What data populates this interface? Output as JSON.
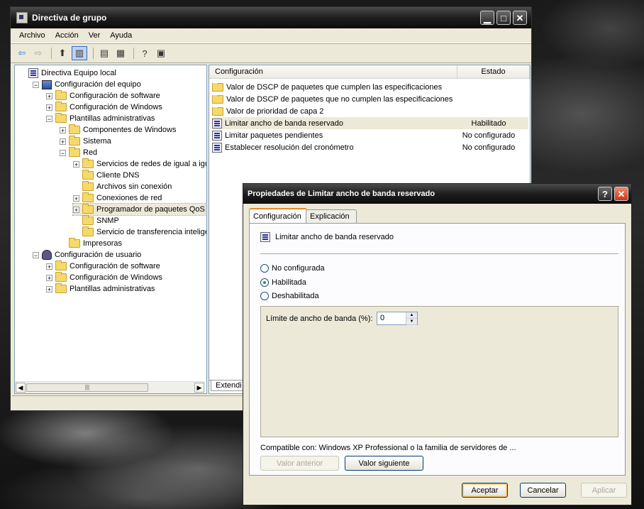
{
  "main_window": {
    "title": "Directiva de grupo",
    "menu": [
      "Archivo",
      "Acción",
      "Ver",
      "Ayuda"
    ],
    "tree": [
      {
        "label": "Directiva Equipo local",
        "icon": "policy-icon",
        "level": 0,
        "expander": ""
      },
      {
        "label": "Configuración del equipo",
        "icon": "computer-icon",
        "level": 1,
        "expander": "-"
      },
      {
        "label": "Configuración de software",
        "icon": "folder-icon",
        "level": 2,
        "expander": "+"
      },
      {
        "label": "Configuración de Windows",
        "icon": "folder-icon",
        "level": 2,
        "expander": "+"
      },
      {
        "label": "Plantillas administrativas",
        "icon": "folder-icon",
        "level": 2,
        "expander": "-"
      },
      {
        "label": "Componentes de Windows",
        "icon": "folder-icon",
        "level": 3,
        "expander": "+"
      },
      {
        "label": "Sistema",
        "icon": "folder-icon",
        "level": 3,
        "expander": "+"
      },
      {
        "label": "Red",
        "icon": "folder-icon",
        "level": 3,
        "expander": "-"
      },
      {
        "label": "Servicios de redes de igual a igual c",
        "icon": "folder-icon",
        "level": 4,
        "expander": "+"
      },
      {
        "label": "Cliente DNS",
        "icon": "folder-icon",
        "level": 4,
        "expander": ""
      },
      {
        "label": "Archivos sin conexión",
        "icon": "folder-icon",
        "level": 4,
        "expander": ""
      },
      {
        "label": "Conexiones de red",
        "icon": "folder-icon",
        "level": 4,
        "expander": "+"
      },
      {
        "label": "Programador de paquetes QoS",
        "icon": "folder-icon",
        "level": 4,
        "expander": "+",
        "selected": true
      },
      {
        "label": "SNMP",
        "icon": "folder-icon",
        "level": 4,
        "expander": ""
      },
      {
        "label": "Servicio de transferencia inteligente",
        "icon": "folder-icon",
        "level": 4,
        "expander": ""
      },
      {
        "label": "Impresoras",
        "icon": "folder-icon",
        "level": 3,
        "expander": ""
      },
      {
        "label": "Configuración de usuario",
        "icon": "user-icon",
        "level": 1,
        "expander": "-"
      },
      {
        "label": "Configuración de software",
        "icon": "folder-icon",
        "level": 2,
        "expander": "+"
      },
      {
        "label": "Configuración de Windows",
        "icon": "folder-icon",
        "level": 2,
        "expander": "+"
      },
      {
        "label": "Plantillas administrativas",
        "icon": "folder-icon",
        "level": 2,
        "expander": "+"
      }
    ],
    "list": {
      "columns": [
        "Configuración",
        "Estado"
      ],
      "rows": [
        {
          "name": "Valor de DSCP de paquetes que cumplen las especificaciones",
          "state": "",
          "icon": "folder-icon"
        },
        {
          "name": "Valor de DSCP de paquetes que no cumplen las especificaciones",
          "state": "",
          "icon": "folder-icon"
        },
        {
          "name": "Valor de prioridad de capa 2",
          "state": "",
          "icon": "folder-icon"
        },
        {
          "name": "Limitar ancho de banda reservado",
          "state": "Habilitado",
          "icon": "policy-icon",
          "selected": true
        },
        {
          "name": "Limitar paquetes pendientes",
          "state": "No configurado",
          "icon": "policy-icon"
        },
        {
          "name": "Establecer resolución del cronómetro",
          "state": "No configurado",
          "icon": "policy-icon"
        }
      ],
      "bottom_tab": "Extendi"
    }
  },
  "dialog": {
    "title": "Propiedades de Limitar ancho de banda reservado",
    "tabs": [
      "Configuración",
      "Explicación"
    ],
    "setting_name": "Limitar ancho de banda reservado",
    "options": [
      "No configurada",
      "Habilitada",
      "Deshabilitada"
    ],
    "selected_option": "Habilitada",
    "bandwidth_label": "Límite de ancho de banda (%):",
    "bandwidth_value": "0",
    "compat": "Compatible con: Windows XP Professional o la familia de servidores de ...",
    "prev_button": "Valor anterior",
    "next_button": "Valor siguiente",
    "ok": "Aceptar",
    "cancel": "Cancelar",
    "apply": "Aplicar"
  }
}
